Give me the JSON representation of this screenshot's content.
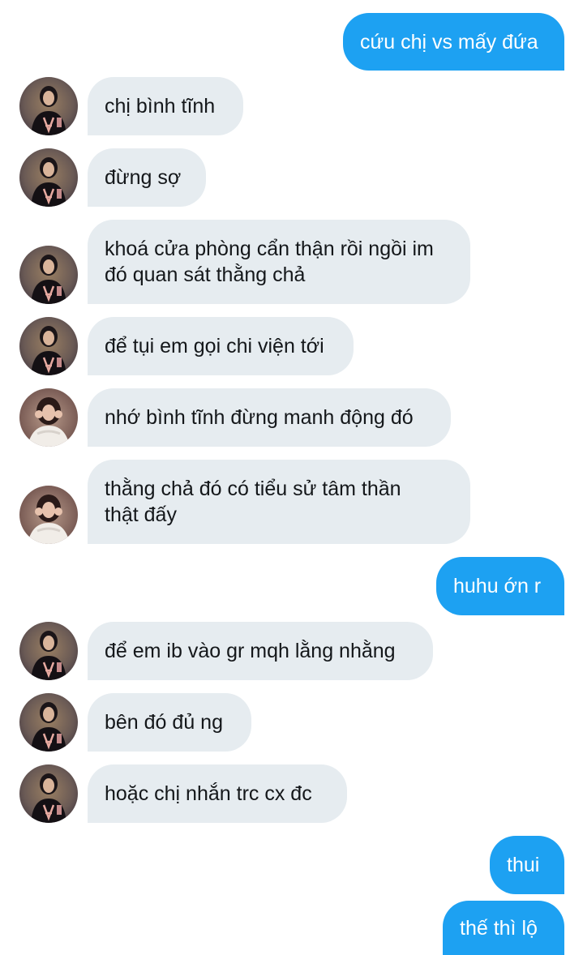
{
  "conversation": {
    "messages": [
      {
        "direction": "outgoing",
        "text": "cứu chị vs mấy đứa"
      },
      {
        "direction": "incoming",
        "avatar": "avatar-a",
        "text": "chị bình tĩnh"
      },
      {
        "direction": "incoming",
        "avatar": "avatar-a",
        "text": "đừng sợ"
      },
      {
        "direction": "incoming",
        "avatar": "avatar-a",
        "text": "khoá cửa phòng cẩn thận rồi ngồi im\nđó quan sát thằng chả"
      },
      {
        "direction": "incoming",
        "avatar": "avatar-a",
        "text": "để tụi em gọi chi viện tới"
      },
      {
        "direction": "incoming",
        "avatar": "avatar-b",
        "text": "nhớ bình tĩnh đừng manh động đó"
      },
      {
        "direction": "incoming",
        "avatar": "avatar-b",
        "text": "thằng chả đó có tiểu sử tâm thần\nthật đấy"
      },
      {
        "direction": "outgoing",
        "text": "huhu ớn r"
      },
      {
        "direction": "incoming",
        "avatar": "avatar-a",
        "text": "để em ib vào gr mqh lằng nhằng"
      },
      {
        "direction": "incoming",
        "avatar": "avatar-a",
        "text": "bên đó đủ ng"
      },
      {
        "direction": "incoming",
        "avatar": "avatar-a",
        "text": "hoặc chị nhắn trc cx đc"
      },
      {
        "direction": "outgoing",
        "text": "thui"
      },
      {
        "direction": "outgoing",
        "text": "thế thì lộ"
      }
    ]
  },
  "colors": {
    "incoming_bubble": "#e6ecf0",
    "incoming_text": "#14171a",
    "outgoing_bubble": "#1da1f2",
    "outgoing_text": "#ffffff",
    "background": "#ffffff"
  },
  "icons": {
    "avatar-a": "profile-photo-dark-shirt",
    "avatar-b": "profile-photo-white-outfit"
  }
}
